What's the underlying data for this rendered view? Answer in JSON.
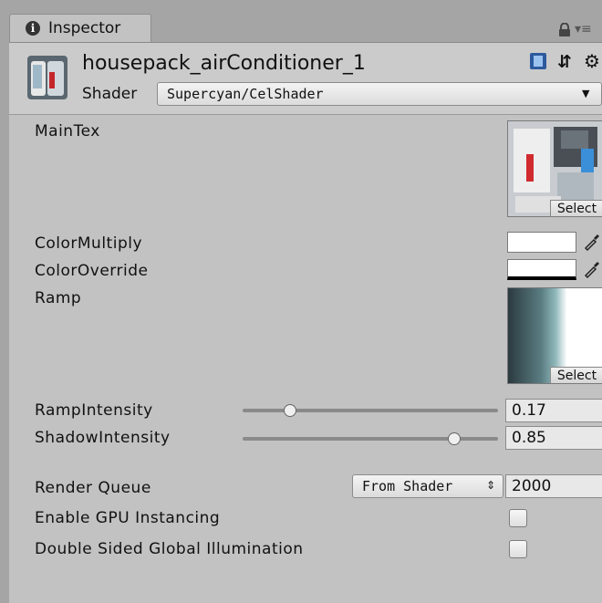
{
  "tab": {
    "label": "Inspector",
    "info_icon": "info-icon"
  },
  "header": {
    "object_name": "housepack_airConditioner_1",
    "shader_label": "Shader",
    "shader_value": "Supercyan/CelShader",
    "icons": [
      "book-icon",
      "preset-icon",
      "gear-icon",
      "lock-icon",
      "menu-icon"
    ]
  },
  "properties": {
    "main_tex": {
      "label": "MainTex",
      "select_label": "Select"
    },
    "color_multiply": {
      "label": "ColorMultiply",
      "color": "#ffffff"
    },
    "color_override": {
      "label": "ColorOverride",
      "color": "#ffffff"
    },
    "ramp": {
      "label": "Ramp",
      "select_label": "Select"
    },
    "ramp_intensity": {
      "label": "RampIntensity",
      "value": "0.17"
    },
    "shadow_intensity": {
      "label": "ShadowIntensity",
      "value": "0.85"
    }
  },
  "render_queue": {
    "label": "Render Queue",
    "mode": "From Shader",
    "value": "2000"
  },
  "gpu_instancing": {
    "label": "Enable GPU Instancing",
    "checked": false
  },
  "double_sided_gi": {
    "label": "Double Sided Global Illumination",
    "checked": false
  },
  "colors": {
    "panel": "#c2c2c2",
    "tab_bar": "#a5a5a5"
  }
}
